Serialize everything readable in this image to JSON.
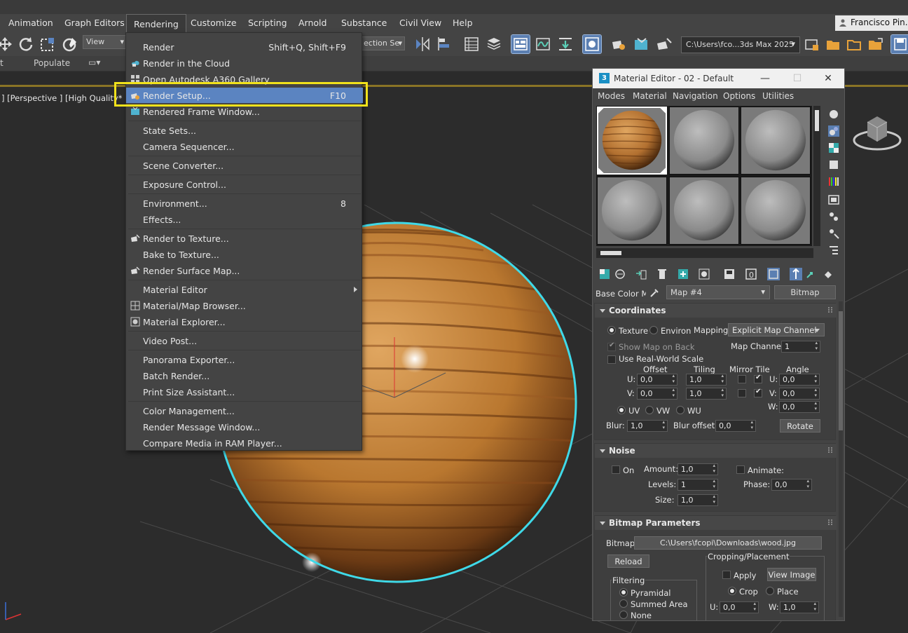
{
  "menubar": {
    "items": [
      "Animation",
      "Graph Editors",
      "Rendering",
      "Customize",
      "Scripting",
      "Arnold",
      "Substance",
      "Civil View",
      "Help"
    ],
    "user": "Francisco Pin..."
  },
  "toolbar": {
    "view_dropdown": "View",
    "selection_set": "ection Se",
    "project_path": "C:\\Users\\fco...3ds Max 2025"
  },
  "ribbon": {
    "left_text": "t",
    "populate": "Populate"
  },
  "viewport": {
    "label": "] [Perspective ] [High Quality* ] [Defa"
  },
  "rendering_menu": {
    "items": [
      {
        "label": "Render",
        "shortcut": "Shift+Q, Shift+F9",
        "icon": ""
      },
      {
        "label": "Render in the Cloud",
        "shortcut": "",
        "icon": "cloud-render-icon"
      },
      {
        "label": "Open Autodesk A360 Gallery",
        "shortcut": "",
        "icon": "gallery-icon"
      },
      {
        "label": "Render Setup...",
        "shortcut": "F10",
        "icon": "render-setup-icon"
      },
      {
        "label": "Rendered Frame Window...",
        "shortcut": "",
        "icon": "frame-window-icon"
      },
      {
        "label": "State Sets...",
        "shortcut": "",
        "icon": ""
      },
      {
        "label": "Camera Sequencer...",
        "shortcut": "",
        "icon": ""
      },
      {
        "label": "Scene Converter...",
        "shortcut": "",
        "icon": ""
      },
      {
        "label": "Exposure Control...",
        "shortcut": "",
        "icon": ""
      },
      {
        "label": "Environment...",
        "shortcut": "8",
        "icon": ""
      },
      {
        "label": "Effects...",
        "shortcut": "",
        "icon": ""
      },
      {
        "label": "Render to Texture...",
        "shortcut": "",
        "icon": "render-to-texture-icon"
      },
      {
        "label": "Bake to Texture...",
        "shortcut": "",
        "icon": ""
      },
      {
        "label": "Render Surface Map...",
        "shortcut": "",
        "icon": "surface-map-icon"
      },
      {
        "label": "Material Editor",
        "shortcut": "",
        "icon": ""
      },
      {
        "label": "Material/Map Browser...",
        "shortcut": "",
        "icon": "material-browser-icon"
      },
      {
        "label": "Material Explorer...",
        "shortcut": "",
        "icon": "material-explorer-icon"
      },
      {
        "label": "Video Post...",
        "shortcut": "",
        "icon": ""
      },
      {
        "label": "Panorama Exporter...",
        "shortcut": "",
        "icon": ""
      },
      {
        "label": "Batch Render...",
        "shortcut": "",
        "icon": ""
      },
      {
        "label": "Print Size Assistant...",
        "shortcut": "",
        "icon": ""
      },
      {
        "label": "Color Management...",
        "shortcut": "",
        "icon": ""
      },
      {
        "label": "Render Message Window...",
        "shortcut": "",
        "icon": ""
      },
      {
        "label": "Compare Media in RAM Player...",
        "shortcut": "",
        "icon": ""
      }
    ],
    "highlighted": "Render Setup...",
    "annotation_color": "#f1e21b"
  },
  "material_editor": {
    "title": "Material Editor - 02 - Default",
    "menu": [
      "Modes",
      "Material",
      "Navigation",
      "Options",
      "Utilities"
    ],
    "base_label": "Base Color Map",
    "map_name": "Map #4",
    "map_type": "Bitmap",
    "coordinates": {
      "title": "Coordinates",
      "texture": "Texture",
      "environ": "Environ",
      "mapping_label": "Mapping:",
      "mapping_value": "Explicit Map Channel",
      "show_map_on_back": "Show Map on Back",
      "map_channel_label": "Map Channel:",
      "map_channel_value": "1",
      "use_real_world": "Use Real-World Scale",
      "offset": "Offset",
      "tiling": "Tiling",
      "mirror_tile": "Mirror Tile",
      "angle": "Angle",
      "u_label": "U:",
      "v_label": "V:",
      "w_label": "W:",
      "u_offset": "0,0",
      "v_offset": "0,0",
      "u_tiling": "1,0",
      "v_tiling": "1,0",
      "u_angle": "0,0",
      "v_angle": "0,0",
      "w_angle": "0,0",
      "uv": "UV",
      "vw": "VW",
      "wu": "WU",
      "blur_label": "Blur:",
      "blur_value": "1,0",
      "blur_offset_label": "Blur offset:",
      "blur_offset_value": "0,0",
      "rotate": "Rotate"
    },
    "noise": {
      "title": "Noise",
      "on": "On",
      "amount_label": "Amount:",
      "amount": "1,0",
      "animate": "Animate:",
      "levels_label": "Levels:",
      "levels": "1",
      "phase_label": "Phase:",
      "phase": "0,0",
      "size_label": "Size:",
      "size": "1,0"
    },
    "bitmap_params": {
      "title": "Bitmap Parameters",
      "bitmap_label": "Bitmap:",
      "bitmap_path": "C:\\Users\\fcopi\\Downloads\\wood.jpg",
      "reload": "Reload",
      "cropping": "Cropping/Placement",
      "apply": "Apply",
      "view_image": "View Image",
      "crop": "Crop",
      "place": "Place",
      "u_label": "U:",
      "u_value": "0,0",
      "w_label": "W:",
      "w_value": "1,0",
      "filtering": "Filtering",
      "pyramidal": "Pyramidal",
      "summed_area": "Summed Area",
      "none": "None"
    }
  },
  "colors": {
    "menu_highlight": "#5b84c1",
    "selection_outline": "#3fd9e8",
    "wood_light": "#d79a4f",
    "wood_dark": "#6b3a14"
  }
}
